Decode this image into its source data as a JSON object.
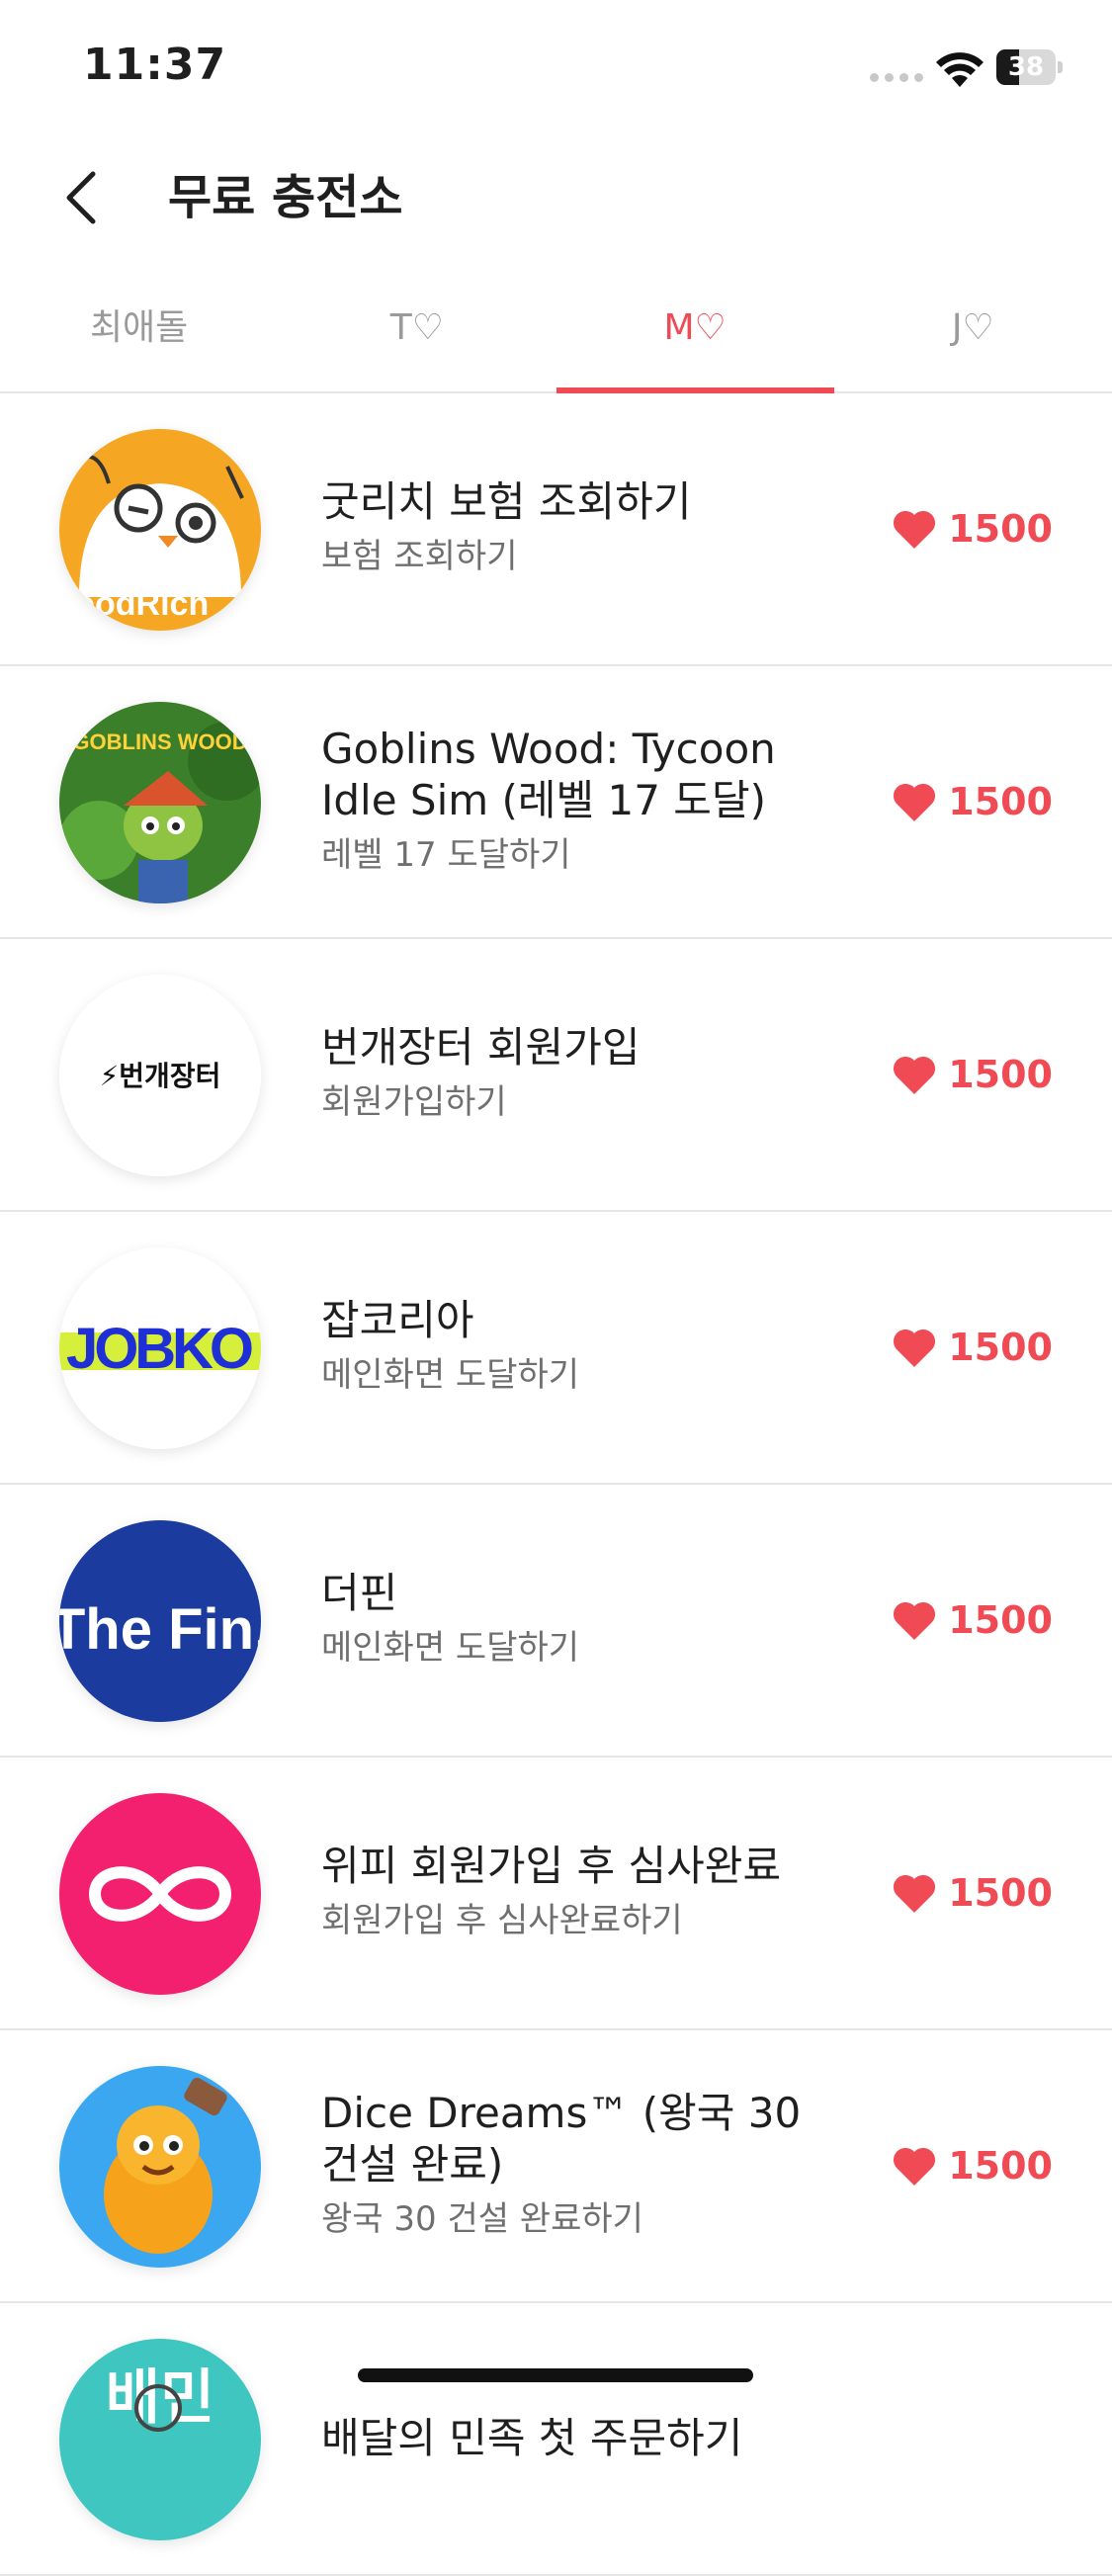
{
  "status_bar": {
    "time": "11:37",
    "battery": "38",
    "battery_level": 0.38
  },
  "header": {
    "title": "무료 충전소"
  },
  "tabs": [
    {
      "label": "최애돌",
      "active": false
    },
    {
      "label": "T♡",
      "active": false
    },
    {
      "label": "M♡",
      "active": true
    },
    {
      "label": "J♡",
      "active": false
    }
  ],
  "items": [
    {
      "title": "굿리치 보험 조회하기",
      "subtitle": "보험 조회하기",
      "reward": "1500",
      "logo_text": "GoodRich"
    },
    {
      "title": "Goblins Wood: Tycoon Idle Sim (레벨 17 도달)",
      "subtitle": "레벨 17 도달하기",
      "reward": "1500",
      "logo_text": "GOBLINS WOOD"
    },
    {
      "title": "번개장터 회원가입",
      "subtitle": "회원가입하기",
      "reward": "1500",
      "logo_text": "⚡번개장터"
    },
    {
      "title": "잡코리아",
      "subtitle": "메인화면 도달하기",
      "reward": "1500",
      "logo_text": "JOBKO"
    },
    {
      "title": "더핀",
      "subtitle": "메인화면 도달하기",
      "reward": "1500",
      "logo_text": "The Fin."
    },
    {
      "title": "위피 회원가입 후 심사완료",
      "subtitle": "회원가입 후 심사완료하기",
      "reward": "1500",
      "logo_text": ""
    },
    {
      "title": "Dice Dreams™ (왕국 30 건설 완료)",
      "subtitle": "왕국 30 건설 완료하기",
      "reward": "1500",
      "logo_text": ""
    },
    {
      "title": "배달의 민족 첫 주문하기",
      "subtitle": "",
      "reward": "",
      "logo_text": "배민"
    }
  ],
  "colors": {
    "accent": "#f04a55",
    "divider": "#e6e6e6",
    "subtext": "#6f6f6f"
  },
  "icons": {
    "back": "chevron-left-icon",
    "reward": "heart-icon"
  }
}
